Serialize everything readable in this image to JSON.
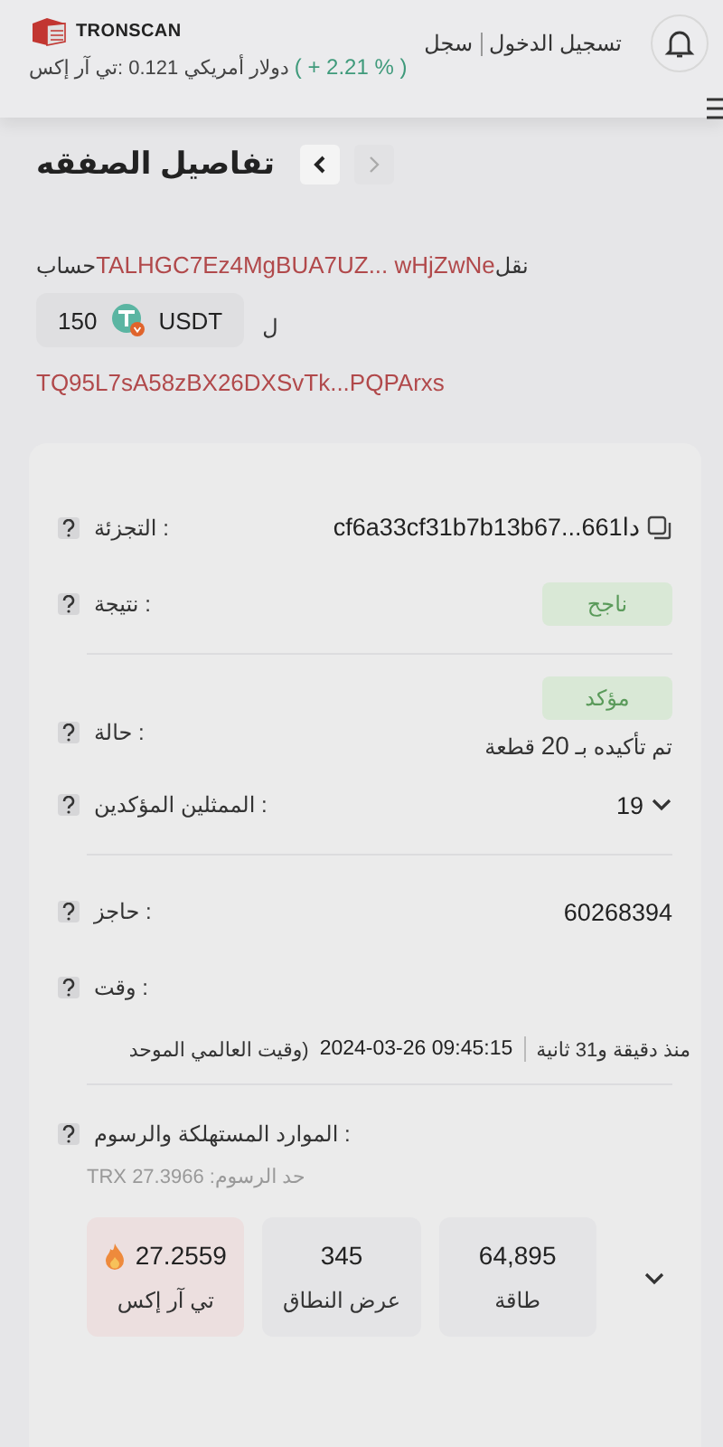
{
  "header": {
    "brand": "TRONSCAN",
    "price_label": "تي آر إكس:",
    "price": "0.121 دولار أمريكي",
    "change": "( + 2.21 % )",
    "register": "سجل",
    "login": "تسجيل الدخول"
  },
  "title": "تفاصيل الصفقه",
  "nav": [
    {
      "kind": "next",
      "disabled": true
    },
    {
      "kind": "previous",
      "disabled": false
    }
  ],
  "transfer": {
    "from_label": "حساب",
    "from_address": "TALHGC7Ez4MgBUA7UZ... wHjZwNe",
    "verb": "نقل",
    "amount": "150",
    "token": "USDT",
    "to_label": "ل",
    "to_address": "TQ95L7sA58zBX26DXSvTk...PQPArxs"
  },
  "rows": [
    {
      "kind": "hash",
      "label": "التجزئة :",
      "value": "cf6a33cf31b7b13b67...661دا",
      "divider": false
    },
    {
      "kind": "badge",
      "label": "نتيجة :",
      "value": "ناجح",
      "divider": true
    },
    {
      "kind": "status",
      "label": "حالة :",
      "value": "مؤكد",
      "note": "تم تأكيده بـ **20** قطعة",
      "divider": false
    },
    {
      "kind": "expander",
      "label": "الممثلين المؤكدين :",
      "value": "19",
      "expanded": false,
      "divider": true
    },
    {
      "kind": "text",
      "label": "حاجز :",
      "value": "60268394",
      "divider": false
    },
    {
      "kind": "time",
      "label": "وقت :",
      "utc": "وقيت العالمي الموحد)",
      "value": "2024-03-26 09:45:15",
      "ago": "منذ دقيقة و31 ثانية",
      "divider": true
    },
    {
      "kind": "resources",
      "label": "الموارد المستهلكة والرسوم :",
      "fee": "TRX حد الرسوم: 27.3966",
      "divider": false,
      "items": [
        {
          "kind": "plain",
          "value": "64,895",
          "caption": "طاقة"
        },
        {
          "kind": "plain",
          "value": "345",
          "caption": "عرض النطاق"
        },
        {
          "kind": "burn",
          "value": "27.2559",
          "caption": "تي آر إكس"
        }
      ],
      "expanded": false
    }
  ]
}
